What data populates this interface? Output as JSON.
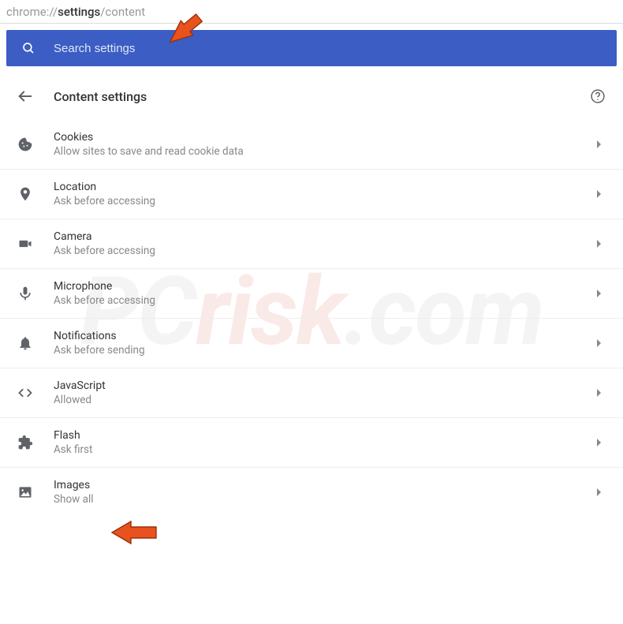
{
  "address": {
    "prefix": "chrome://",
    "bold": "settings",
    "suffix": "/content"
  },
  "search": {
    "placeholder": "Search settings"
  },
  "header": {
    "title": "Content settings"
  },
  "items": [
    {
      "icon": "cookie",
      "title": "Cookies",
      "sub": "Allow sites to save and read cookie data"
    },
    {
      "icon": "location",
      "title": "Location",
      "sub": "Ask before accessing"
    },
    {
      "icon": "camera",
      "title": "Camera",
      "sub": "Ask before accessing"
    },
    {
      "icon": "microphone",
      "title": "Microphone",
      "sub": "Ask before accessing"
    },
    {
      "icon": "bell",
      "title": "Notifications",
      "sub": "Ask before sending"
    },
    {
      "icon": "code",
      "title": "JavaScript",
      "sub": "Allowed"
    },
    {
      "icon": "extension",
      "title": "Flash",
      "sub": "Ask first"
    },
    {
      "icon": "image",
      "title": "Images",
      "sub": "Show all"
    }
  ],
  "watermark": {
    "a": "PC",
    "b": "risk",
    "c": ".com"
  }
}
